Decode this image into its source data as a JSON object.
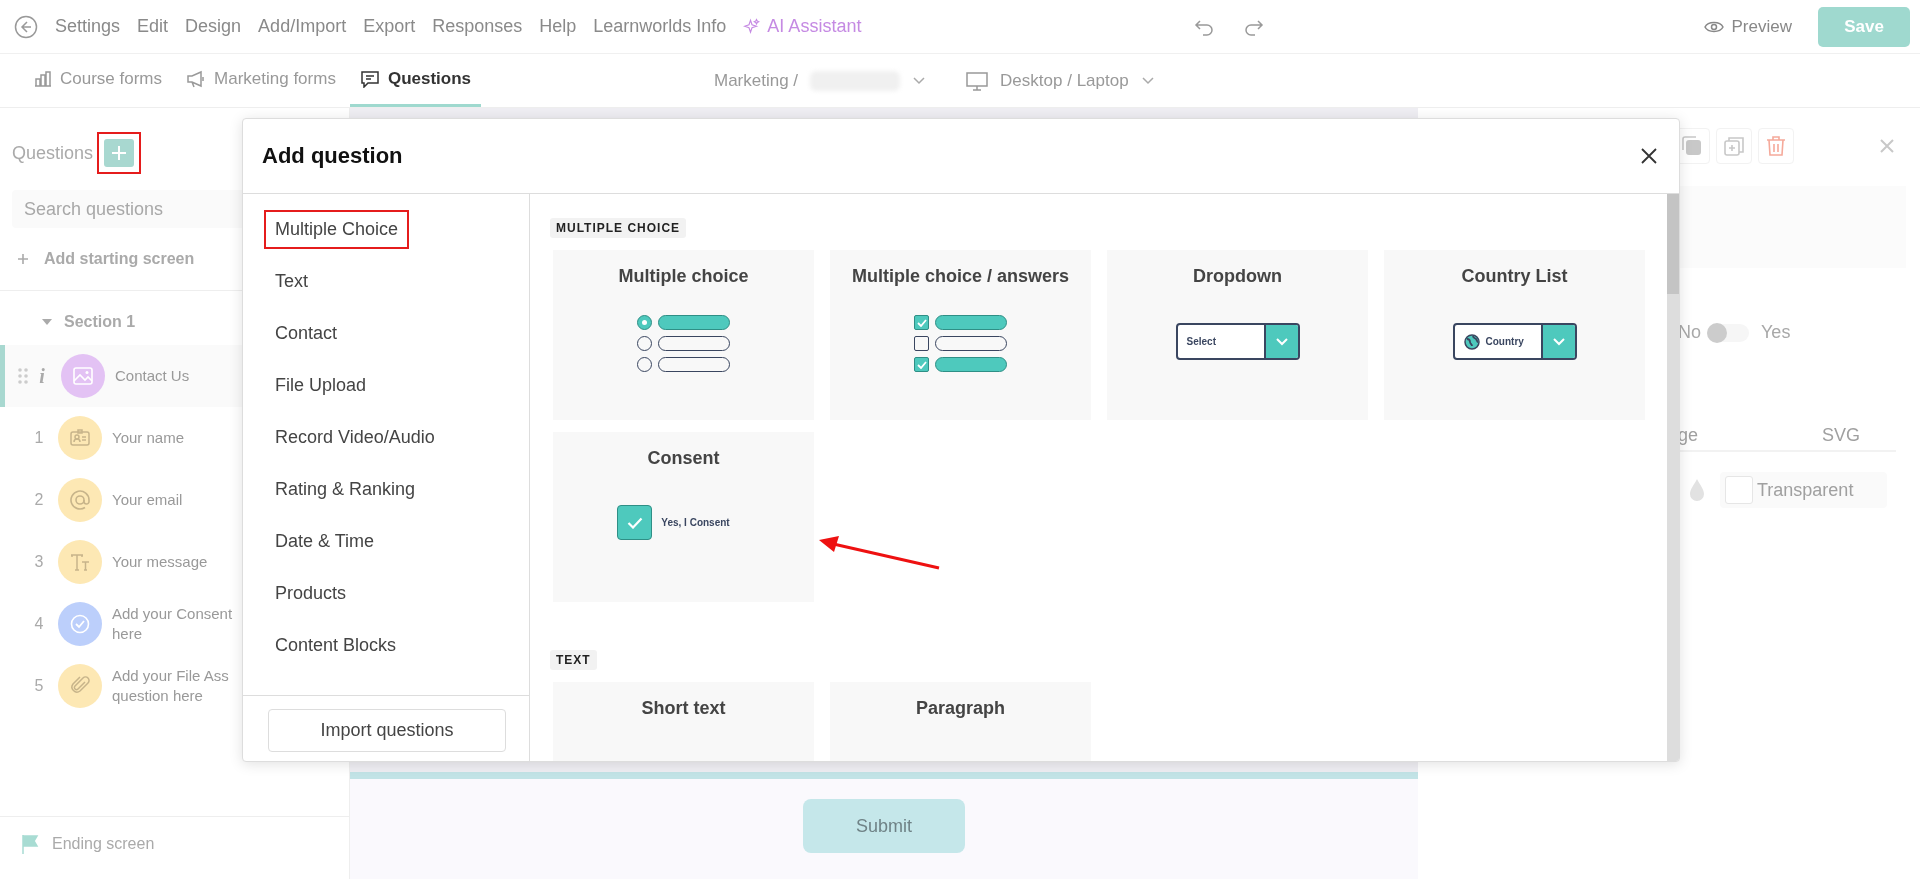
{
  "menu": [
    {
      "label": "Settings",
      "kind": "plain"
    },
    {
      "label": "Edit",
      "kind": "plain"
    },
    {
      "label": "Design",
      "kind": "plain"
    },
    {
      "label": "Add/Import",
      "kind": "plain"
    },
    {
      "label": "Export",
      "kind": "plain"
    },
    {
      "label": "Responses",
      "kind": "plain"
    },
    {
      "label": "Help",
      "kind": "plain"
    },
    {
      "label": "Learnworlds Info",
      "kind": "plain"
    },
    {
      "label": "AI Assistant",
      "kind": "ai"
    }
  ],
  "header_actions": {
    "preview": "Preview",
    "save": "Save"
  },
  "tabs": [
    {
      "label": "Course forms",
      "kind": "chart",
      "selected": false
    },
    {
      "label": "Marketing forms",
      "kind": "megaphone",
      "selected": false
    },
    {
      "label": "Questions",
      "kind": "chat",
      "selected": true
    }
  ],
  "view_selectors": {
    "form": "Marketing /",
    "device": "Desktop / Laptop"
  },
  "sidebar": {
    "title": "Questions",
    "add_highlighted": true,
    "search_placeholder": "Search questions",
    "add_starting_screen": "Add starting screen",
    "section": {
      "title": "Section 1",
      "expanded": true
    },
    "items": [
      {
        "kind": "image",
        "marker": "i",
        "label": "Contact Us",
        "selected": true,
        "color": "#e3c2f4"
      },
      {
        "kind": "id",
        "marker": "1",
        "label": "Your name",
        "selected": false,
        "color": "#fde8b4"
      },
      {
        "kind": "email",
        "marker": "2",
        "label": "Your email",
        "selected": false,
        "color": "#fde8b4"
      },
      {
        "kind": "text",
        "marker": "3",
        "label": "Your message",
        "selected": false,
        "color": "#fde8b4"
      },
      {
        "kind": "consent",
        "marker": "4",
        "label": "Add your Consent here",
        "selected": false,
        "color": "#bccffb"
      },
      {
        "kind": "file",
        "marker": "5",
        "label": "Add your File Ass question here",
        "selected": false,
        "color": "#fde8b4"
      }
    ],
    "ending_screen": "Ending screen"
  },
  "canvas": {
    "submit": "Submit"
  },
  "right_panel": {
    "toggle": {
      "off_label": "No",
      "on_label": "Yes",
      "on": false
    },
    "tabs": [
      "ge",
      "SVG"
    ],
    "color_field": "Transparent"
  },
  "modal": {
    "title": "Add question",
    "categories": [
      {
        "label": "Multiple Choice",
        "highlighted": true
      },
      {
        "label": "Text",
        "highlighted": false
      },
      {
        "label": "Contact",
        "highlighted": false
      },
      {
        "label": "File Upload",
        "highlighted": false
      },
      {
        "label": "Record Video/Audio",
        "highlighted": false
      },
      {
        "label": "Rating & Ranking",
        "highlighted": false
      },
      {
        "label": "Date & Time",
        "highlighted": false
      },
      {
        "label": "Products",
        "highlighted": false
      },
      {
        "label": "Content Blocks",
        "highlighted": false
      }
    ],
    "import_button": "Import questions",
    "sections": [
      {
        "label": "MULTIPLE CHOICE",
        "cards": [
          {
            "title": "Multiple choice",
            "kind": "radio",
            "options": [
              {
                "checked": true
              },
              {
                "checked": false
              },
              {
                "checked": false
              }
            ]
          },
          {
            "title": "Multiple choice / answers",
            "kind": "checkbox",
            "options": [
              {
                "checked": true
              },
              {
                "checked": false
              },
              {
                "checked": true
              }
            ]
          },
          {
            "title": "Dropdown",
            "kind": "dropdown",
            "sample": "Select"
          },
          {
            "title": "Country List",
            "kind": "country",
            "sample": "Country"
          },
          {
            "title": "Consent",
            "kind": "consent",
            "sample": "Yes, I Consent",
            "checked": true
          }
        ]
      },
      {
        "label": "TEXT",
        "cards": [
          {
            "title": "Short text",
            "kind": "text"
          },
          {
            "title": "Paragraph",
            "kind": "text"
          }
        ]
      }
    ]
  },
  "annotations": {
    "arrow": true
  }
}
